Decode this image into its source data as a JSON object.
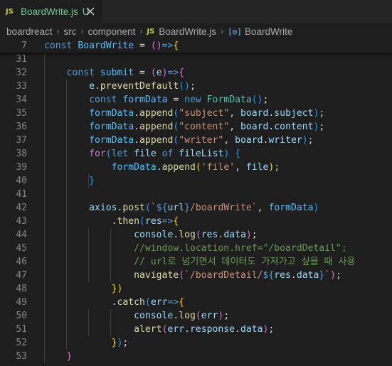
{
  "tab": {
    "language_badge": "JS",
    "filename": "BoardWrite.js",
    "status": "U",
    "close_icon": "close-icon"
  },
  "breadcrumb": {
    "items": [
      "boardreact",
      "src",
      "component",
      "BoardWrite.js",
      "BoardWrite"
    ],
    "file_badge": "JS",
    "symbol_icon": "symbol-variable-icon",
    "separator": "›"
  },
  "sticky": {
    "line_number": "7",
    "tokens": [
      {
        "t": "const ",
        "c": "k"
      },
      {
        "t": "BoardWrite",
        "c": "n"
      },
      {
        "t": " = ",
        "c": "p"
      },
      {
        "t": "()",
        "c": "b2"
      },
      {
        "t": "=>",
        "c": "k"
      },
      {
        "t": "{",
        "c": "b1"
      }
    ]
  },
  "code_lines": [
    {
      "n": "31",
      "tokens": []
    },
    {
      "n": "32",
      "tokens": [
        {
          "t": "    ",
          "c": "p"
        },
        {
          "t": "const ",
          "c": "k"
        },
        {
          "t": "submit",
          "c": "n"
        },
        {
          "t": " = ",
          "c": "p"
        },
        {
          "t": "(",
          "c": "b2"
        },
        {
          "t": "e",
          "c": "v"
        },
        {
          "t": ")",
          "c": "b2"
        },
        {
          "t": "=>",
          "c": "k"
        },
        {
          "t": "{",
          "c": "b2"
        }
      ]
    },
    {
      "n": "33",
      "tokens": [
        {
          "t": "        ",
          "c": "p"
        },
        {
          "t": "e",
          "c": "v"
        },
        {
          "t": ".",
          "c": "p"
        },
        {
          "t": "preventDefault",
          "c": "f"
        },
        {
          "t": "()",
          "c": "b3"
        },
        {
          "t": ";",
          "c": "p"
        }
      ]
    },
    {
      "n": "34",
      "tokens": [
        {
          "t": "        ",
          "c": "p"
        },
        {
          "t": "const ",
          "c": "k"
        },
        {
          "t": "formData",
          "c": "n"
        },
        {
          "t": " = ",
          "c": "p"
        },
        {
          "t": "new ",
          "c": "k"
        },
        {
          "t": "FormData",
          "c": "t"
        },
        {
          "t": "()",
          "c": "b3"
        },
        {
          "t": ";",
          "c": "p"
        }
      ]
    },
    {
      "n": "35",
      "tokens": [
        {
          "t": "        ",
          "c": "p"
        },
        {
          "t": "formData",
          "c": "n"
        },
        {
          "t": ".",
          "c": "p"
        },
        {
          "t": "append",
          "c": "f"
        },
        {
          "t": "(",
          "c": "b3"
        },
        {
          "t": "\"subject\"",
          "c": "s"
        },
        {
          "t": ", ",
          "c": "p"
        },
        {
          "t": "board",
          "c": "v"
        },
        {
          "t": ".",
          "c": "p"
        },
        {
          "t": "subject",
          "c": "v"
        },
        {
          "t": ")",
          "c": "b3"
        },
        {
          "t": ";",
          "c": "p"
        }
      ]
    },
    {
      "n": "36",
      "tokens": [
        {
          "t": "        ",
          "c": "p"
        },
        {
          "t": "formData",
          "c": "n"
        },
        {
          "t": ".",
          "c": "p"
        },
        {
          "t": "append",
          "c": "f"
        },
        {
          "t": "(",
          "c": "b3"
        },
        {
          "t": "\"content\"",
          "c": "s"
        },
        {
          "t": ", ",
          "c": "p"
        },
        {
          "t": "board",
          "c": "v"
        },
        {
          "t": ".",
          "c": "p"
        },
        {
          "t": "content",
          "c": "v"
        },
        {
          "t": ")",
          "c": "b3"
        },
        {
          "t": ";",
          "c": "p"
        }
      ]
    },
    {
      "n": "37",
      "tokens": [
        {
          "t": "        ",
          "c": "p"
        },
        {
          "t": "formData",
          "c": "n"
        },
        {
          "t": ".",
          "c": "p"
        },
        {
          "t": "append",
          "c": "f"
        },
        {
          "t": "(",
          "c": "b3"
        },
        {
          "t": "\"writer\"",
          "c": "s"
        },
        {
          "t": ", ",
          "c": "p"
        },
        {
          "t": "board",
          "c": "v"
        },
        {
          "t": ".",
          "c": "p"
        },
        {
          "t": "writer",
          "c": "v"
        },
        {
          "t": ")",
          "c": "b3"
        },
        {
          "t": ";",
          "c": "p"
        }
      ]
    },
    {
      "n": "38",
      "tokens": [
        {
          "t": "        ",
          "c": "p"
        },
        {
          "t": "for",
          "c": "c"
        },
        {
          "t": "(",
          "c": "b3"
        },
        {
          "t": "let ",
          "c": "k"
        },
        {
          "t": "file",
          "c": "v"
        },
        {
          "t": " of ",
          "c": "k"
        },
        {
          "t": "fileList",
          "c": "v"
        },
        {
          "t": ") ",
          "c": "b3"
        },
        {
          "t": "{",
          "c": "b3"
        }
      ]
    },
    {
      "n": "39",
      "tokens": [
        {
          "t": "            ",
          "c": "p"
        },
        {
          "t": "formData",
          "c": "n"
        },
        {
          "t": ".",
          "c": "p"
        },
        {
          "t": "append",
          "c": "f"
        },
        {
          "t": "(",
          "c": "b1"
        },
        {
          "t": "'file'",
          "c": "s"
        },
        {
          "t": ", ",
          "c": "p"
        },
        {
          "t": "file",
          "c": "v"
        },
        {
          "t": ")",
          "c": "b1"
        },
        {
          "t": ";",
          "c": "p"
        }
      ]
    },
    {
      "n": "40",
      "tokens": [
        {
          "t": "        ",
          "c": "p"
        },
        {
          "t": "}",
          "c": "b3"
        }
      ]
    },
    {
      "n": "41",
      "tokens": []
    },
    {
      "n": "42",
      "tokens": [
        {
          "t": "        ",
          "c": "p"
        },
        {
          "t": "axios",
          "c": "v"
        },
        {
          "t": ".",
          "c": "p"
        },
        {
          "t": "post",
          "c": "f"
        },
        {
          "t": "(",
          "c": "b3"
        },
        {
          "t": "`",
          "c": "s"
        },
        {
          "t": "${",
          "c": "k"
        },
        {
          "t": "url",
          "c": "v"
        },
        {
          "t": "}",
          "c": "k"
        },
        {
          "t": "/boardWrite`",
          "c": "s"
        },
        {
          "t": ", ",
          "c": "p"
        },
        {
          "t": "formData",
          "c": "n"
        },
        {
          "t": ")",
          "c": "b3"
        }
      ]
    },
    {
      "n": "43",
      "tokens": [
        {
          "t": "            ",
          "c": "p"
        },
        {
          "t": ".",
          "c": "p"
        },
        {
          "t": "then",
          "c": "f"
        },
        {
          "t": "(",
          "c": "b3"
        },
        {
          "t": "res",
          "c": "v"
        },
        {
          "t": "=>",
          "c": "k"
        },
        {
          "t": "{",
          "c": "b1"
        }
      ]
    },
    {
      "n": "44",
      "tokens": [
        {
          "t": "                ",
          "c": "p"
        },
        {
          "t": "console",
          "c": "v"
        },
        {
          "t": ".",
          "c": "p"
        },
        {
          "t": "log",
          "c": "f"
        },
        {
          "t": "(",
          "c": "b2"
        },
        {
          "t": "res",
          "c": "v"
        },
        {
          "t": ".",
          "c": "p"
        },
        {
          "t": "data",
          "c": "v"
        },
        {
          "t": ")",
          "c": "b2"
        },
        {
          "t": ";",
          "c": "p"
        }
      ]
    },
    {
      "n": "45",
      "tokens": [
        {
          "t": "                ",
          "c": "p"
        },
        {
          "t": "//window.location.href=\"/boardDetail\";",
          "c": "m"
        }
      ]
    },
    {
      "n": "46",
      "tokens": [
        {
          "t": "                ",
          "c": "p"
        },
        {
          "t": "// url로 넘기면서 데이터도 가져가고 싶을 때 사용",
          "c": "m"
        }
      ]
    },
    {
      "n": "47",
      "tokens": [
        {
          "t": "                ",
          "c": "p"
        },
        {
          "t": "navigate",
          "c": "f"
        },
        {
          "t": "(",
          "c": "b2"
        },
        {
          "t": "`/boardDetail/",
          "c": "s"
        },
        {
          "t": "${",
          "c": "k"
        },
        {
          "t": "res",
          "c": "v"
        },
        {
          "t": ".",
          "c": "p"
        },
        {
          "t": "data",
          "c": "v"
        },
        {
          "t": "}",
          "c": "k"
        },
        {
          "t": "`",
          "c": "s"
        },
        {
          "t": ")",
          "c": "b2"
        },
        {
          "t": ";",
          "c": "p"
        }
      ]
    },
    {
      "n": "48",
      "tokens": [
        {
          "t": "            ",
          "c": "p"
        },
        {
          "t": "})",
          "c": "b1"
        }
      ]
    },
    {
      "n": "49",
      "tokens": [
        {
          "t": "            ",
          "c": "p"
        },
        {
          "t": ".",
          "c": "p"
        },
        {
          "t": "catch",
          "c": "f"
        },
        {
          "t": "(",
          "c": "b3"
        },
        {
          "t": "err",
          "c": "v"
        },
        {
          "t": "=>",
          "c": "k"
        },
        {
          "t": "{",
          "c": "b1"
        }
      ]
    },
    {
      "n": "50",
      "tokens": [
        {
          "t": "                ",
          "c": "p"
        },
        {
          "t": "console",
          "c": "v"
        },
        {
          "t": ".",
          "c": "p"
        },
        {
          "t": "log",
          "c": "f"
        },
        {
          "t": "(",
          "c": "b2"
        },
        {
          "t": "err",
          "c": "v"
        },
        {
          "t": ")",
          "c": "b2"
        },
        {
          "t": ";",
          "c": "p"
        }
      ]
    },
    {
      "n": "51",
      "tokens": [
        {
          "t": "                ",
          "c": "p"
        },
        {
          "t": "alert",
          "c": "f"
        },
        {
          "t": "(",
          "c": "b2"
        },
        {
          "t": "err",
          "c": "v"
        },
        {
          "t": ".",
          "c": "p"
        },
        {
          "t": "response",
          "c": "v"
        },
        {
          "t": ".",
          "c": "p"
        },
        {
          "t": "data",
          "c": "v"
        },
        {
          "t": ")",
          "c": "b2"
        },
        {
          "t": ";",
          "c": "p"
        }
      ]
    },
    {
      "n": "52",
      "tokens": [
        {
          "t": "            ",
          "c": "p"
        },
        {
          "t": "}",
          "c": "b1"
        },
        {
          "t": ")",
          "c": "b3"
        },
        {
          "t": ";",
          "c": "p"
        }
      ]
    },
    {
      "n": "53",
      "tokens": [
        {
          "t": "    ",
          "c": "p"
        },
        {
          "t": "}",
          "c": "b2"
        }
      ]
    }
  ],
  "colors": {
    "editor_bg": "#1e1e1e",
    "tab_bar_bg": "#252526",
    "untracked_file": "#73c991",
    "js_badge": "#cbcb41"
  }
}
